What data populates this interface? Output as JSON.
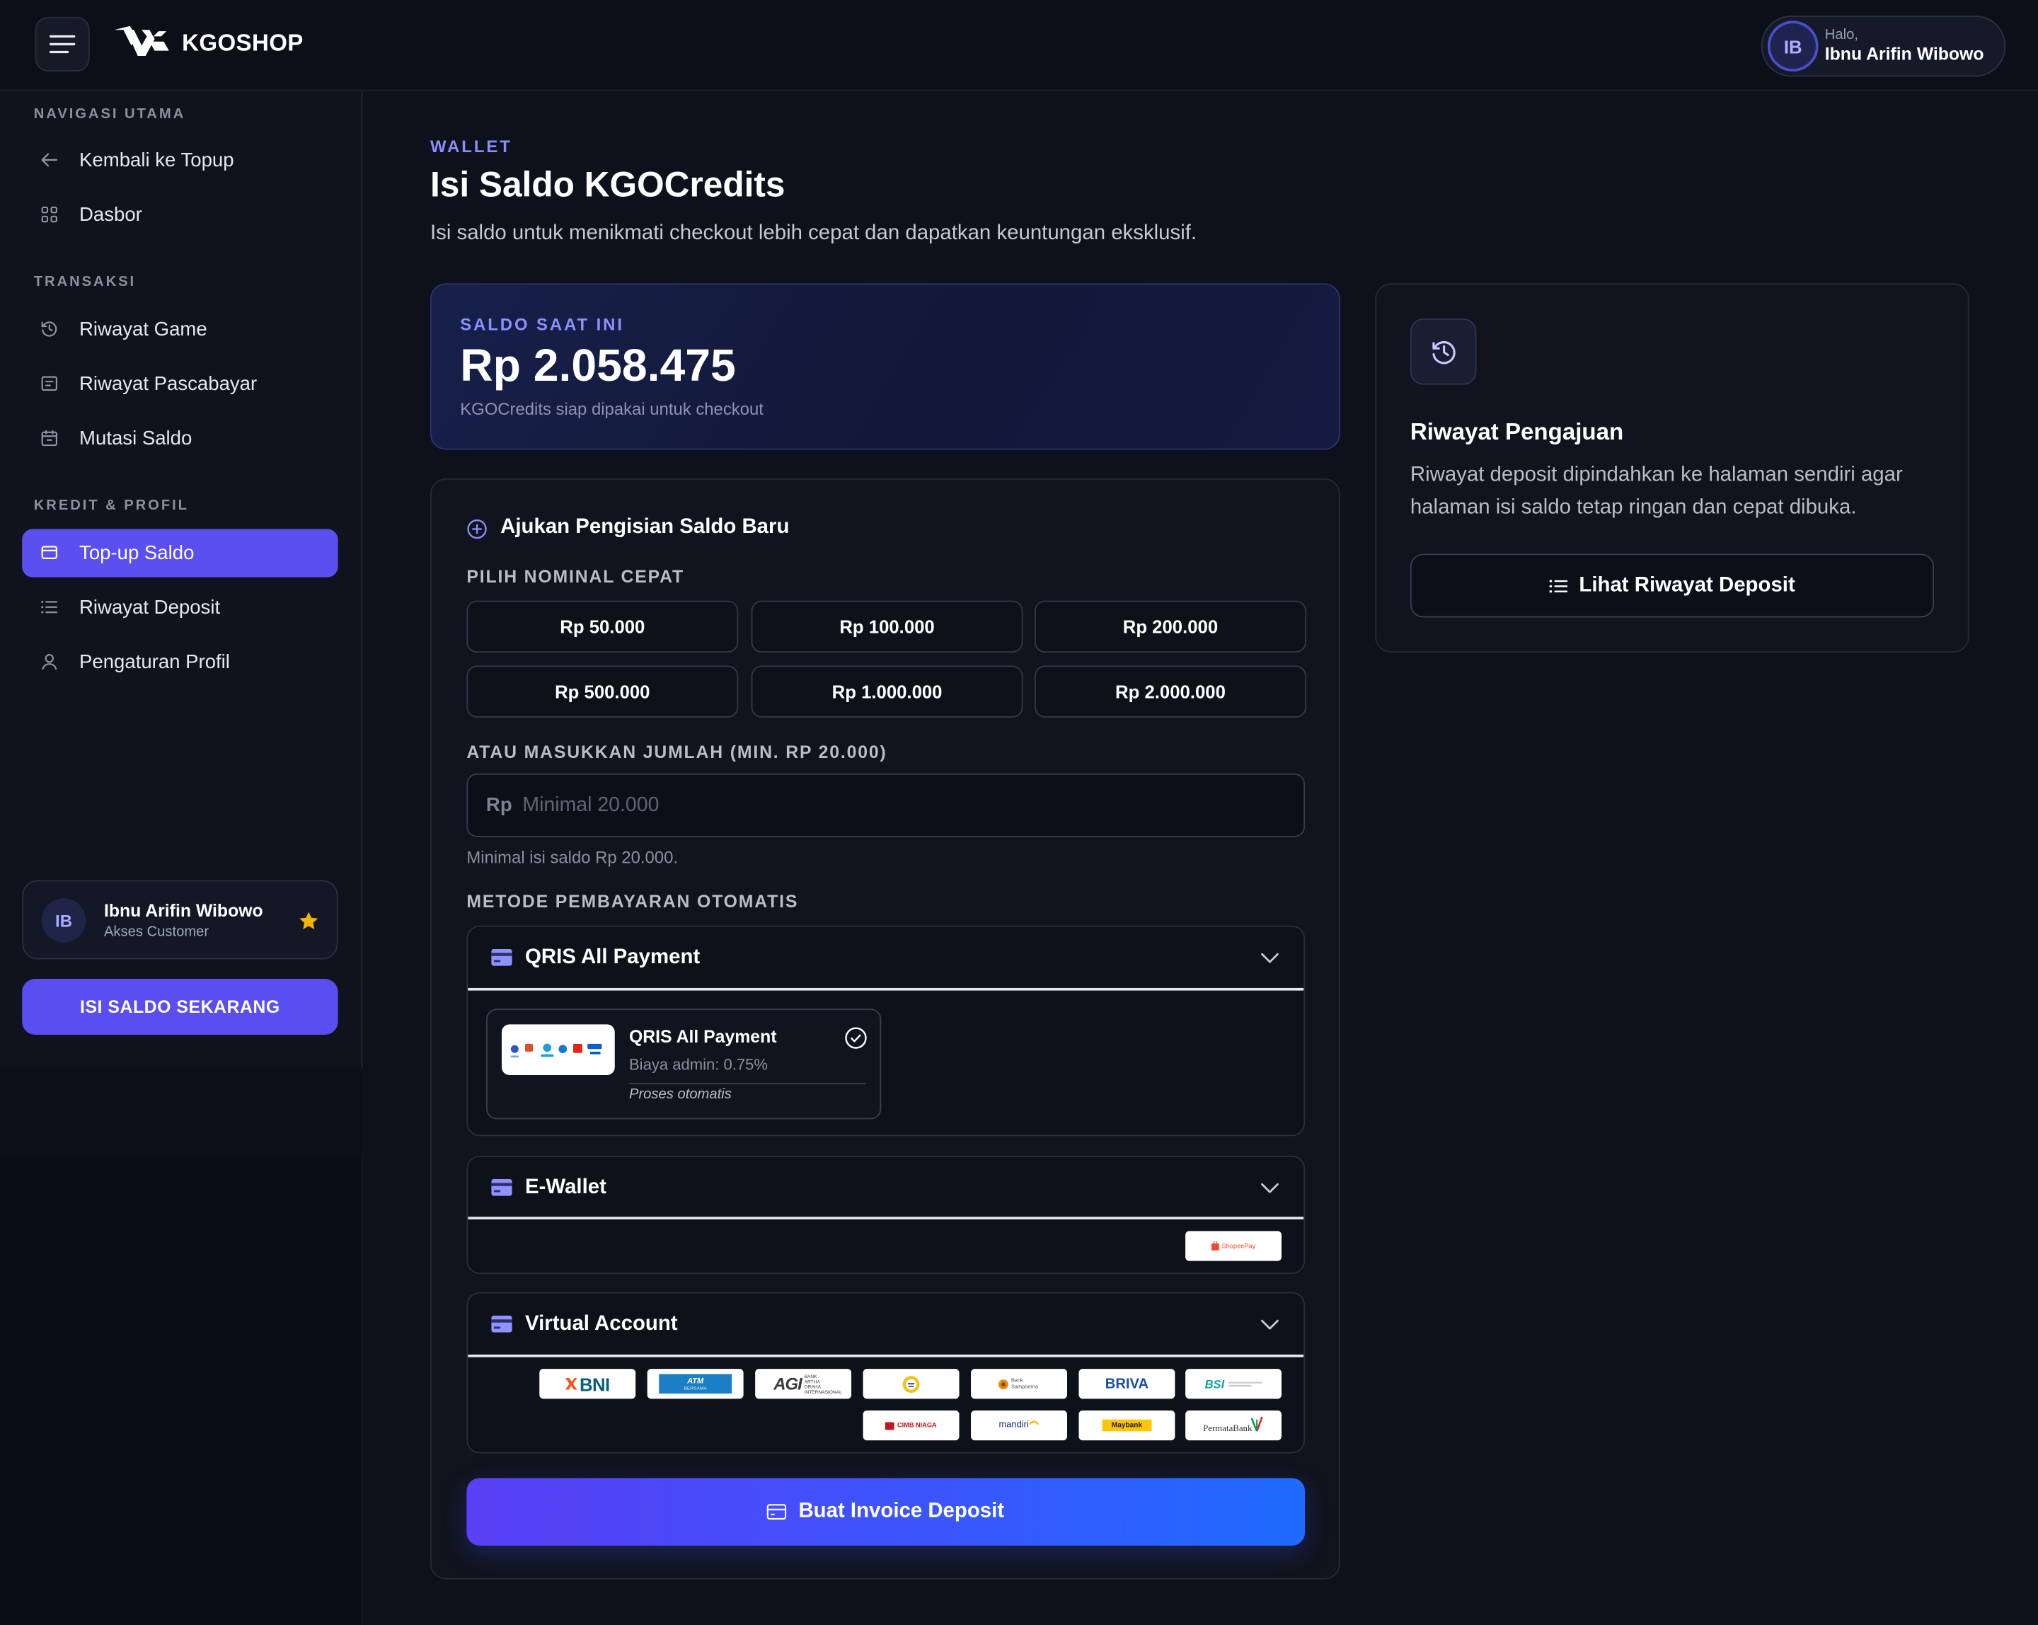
{
  "brand": {
    "name": "KGOSHOP",
    "icon": "kgoshop-logo-icon"
  },
  "header": {
    "greeting": "Halo,",
    "user_name": "Ibnu Arifin Wibowo",
    "avatar_initials": "IB",
    "menu_icon": "hamburger-icon"
  },
  "sidebar": {
    "sections": [
      {
        "title": "NAVIGASI UTAMA",
        "items": [
          {
            "label": "Kembali ke Topup",
            "icon": "arrow-left-icon"
          },
          {
            "label": "Dasbor",
            "icon": "grid-icon"
          }
        ]
      },
      {
        "title": "TRANSAKSI",
        "items": [
          {
            "label": "Riwayat Game",
            "icon": "history-icon"
          },
          {
            "label": "Riwayat Pascabayar",
            "icon": "receipt-icon"
          },
          {
            "label": "Mutasi Saldo",
            "icon": "calendar-icon"
          }
        ]
      },
      {
        "title": "KREDIT & PROFIL",
        "items": [
          {
            "label": "Top-up Saldo",
            "icon": "wallet-icon",
            "active": true
          },
          {
            "label": "Riwayat Deposit",
            "icon": "list-icon"
          },
          {
            "label": "Pengaturan Profil",
            "icon": "user-icon"
          }
        ]
      }
    ],
    "user_card": {
      "initials": "IB",
      "name": "Ibnu Arifin Wibowo",
      "role": "Akses Customer",
      "icon": "star-icon"
    },
    "cta": "ISI SALDO SEKARANG"
  },
  "page": {
    "eyebrow": "WALLET",
    "title": "Isi Saldo KGOCredits",
    "subtitle": "Isi saldo untuk menikmati checkout lebih cepat dan dapatkan keuntungan eksklusif."
  },
  "balance": {
    "label": "SALDO SAAT INI",
    "amount": "Rp 2.058.475",
    "note": "KGOCredits siap dipakai untuk checkout"
  },
  "form": {
    "title": "Ajukan Pengisian Saldo Baru",
    "title_icon": "plus-circle-icon",
    "quick_label": "PILIH NOMINAL CEPAT",
    "quick_options": [
      "Rp 50.000",
      "Rp 100.000",
      "Rp 200.000",
      "Rp 500.000",
      "Rp 1.000.000",
      "Rp 2.000.000"
    ],
    "custom_label": "ATAU MASUKKAN JUMLAH (MIN. RP 20.000)",
    "currency_prefix": "Rp",
    "amount_placeholder": "Minimal 20.000",
    "amount_value": "",
    "hint": "Minimal isi saldo Rp 20.000.",
    "methods_label": "METODE PEMBAYARAN OTOMATIS",
    "methods": [
      {
        "name": "QRIS All Payment",
        "icon": "credit-card-icon",
        "expanded": true,
        "options": [
          {
            "name": "QRIS All Payment",
            "fee": "Biaya admin: 0.75%",
            "process": "Proses otomatis",
            "selected": true,
            "logo": "qris-partners-logo"
          }
        ]
      },
      {
        "name": "E-Wallet",
        "icon": "credit-card-icon",
        "logos": [
          {
            "label": "ShopeePay",
            "icon": "shopeepay-logo"
          }
        ]
      },
      {
        "name": "Virtual Account",
        "icon": "credit-card-icon",
        "logos": [
          {
            "label": "BNI",
            "icon": "bni-logo"
          },
          {
            "label": "ATM",
            "sub": "BERSAMA",
            "icon": "atm-bersama-logo"
          },
          {
            "label": "AGI",
            "sub": "BANK ARTHA GRAHA INTERNASIONAL",
            "icon": "agi-logo"
          },
          {
            "icon": "bank-emblem-logo"
          },
          {
            "label": "Bank Sampoerna",
            "icon": "sampoerna-logo"
          },
          {
            "label": "BRIVA",
            "icon": "briva-logo"
          },
          {
            "label": "BSI",
            "icon": "bsi-logo"
          },
          {
            "label": "CIMB NIAGA",
            "icon": "cimb-niaga-logo"
          },
          {
            "label": "mandiri",
            "icon": "mandiri-logo"
          },
          {
            "label": "Maybank",
            "icon": "maybank-logo"
          },
          {
            "label": "PermataBank",
            "icon": "permatabank-logo"
          }
        ]
      }
    ],
    "submit": "Buat Invoice Deposit",
    "submit_icon": "credit-card-icon"
  },
  "history_card": {
    "icon": "history-icon",
    "title": "Riwayat Pengajuan",
    "description": "Riwayat deposit dipindahkan ke halaman sendiri agar halaman isi saldo tetap ringan dan cepat dibuka.",
    "button": "Lihat Riwayat Deposit",
    "button_icon": "list-icon"
  },
  "colors": {
    "background": "#0e111b",
    "accent": "#5b4ff0",
    "eyebrow": "#8b8dfb",
    "submit_gradient_start": "#5a3ff5",
    "submit_gradient_end": "#1f6bff",
    "star": "#f5b400"
  }
}
